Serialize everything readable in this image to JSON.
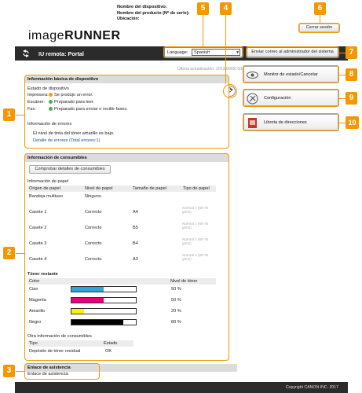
{
  "header": {
    "logo_main": "image",
    "logo_bold": "RUNNER",
    "device_name_label": "Nombre del dispositivo:",
    "product_name_label": "Nombre del producto (Nº de serie):",
    "location_label": "Ubicación:",
    "logout_label": "Cerrar sesión",
    "portal_title": "IU remota: Portal",
    "language_label": "Language:",
    "language_value": "Spanish",
    "mail_button": "Enviar correo al administrador del sistema",
    "last_updated": "Última actualización: 2013/00/00 00:00:00"
  },
  "basic_info": {
    "title": "Información básica de dispositivo",
    "status_title": "Estado de dispositivo",
    "printer_label": "Impresora:",
    "printer_status": "Se produjo un error.",
    "scanner_label": "Escáner:",
    "scanner_status": "Preparado para leer.",
    "fax_label": "Fax:",
    "fax_status": "Preparado para enviar o recibir faxes.",
    "errors_title": "Información de errores",
    "error_message": "El nivel de tinta del tóner amarillo es bajo.",
    "error_link": "Detalle de errores (Total errores:1)"
  },
  "consumables": {
    "title": "Información de consumibles",
    "check_button": "Comprobar detalles de consumibles",
    "paper_title": "Información de papel",
    "paper_headers": [
      "Origen de papel",
      "Nivel de papel",
      "Tamaño de papel",
      "Tipo de papel"
    ],
    "paper_rows": [
      {
        "source": "Bandeja multiuso",
        "level": "Ninguno",
        "size": "",
        "type": ""
      },
      {
        "source": "Casete 1",
        "level": "Correcto",
        "size": "A4",
        "type": "Normal 1 (60-75 g/m2)"
      },
      {
        "source": "Casete 2",
        "level": "Correcto",
        "size": "B5",
        "type": "Normal 1 (60-75 g/m2)"
      },
      {
        "source": "Casete 3",
        "level": "Correcto",
        "size": "B4",
        "type": "Normal 1 (60-75 g/m2)"
      },
      {
        "source": "Casete 4",
        "level": "Correcto",
        "size": "A3",
        "type": "Normal 1 (60-75 g/m2)"
      }
    ],
    "toner_title": "Tóner restante",
    "toner_headers": [
      "Color",
      "Nivel de tóner"
    ],
    "toner_rows": [
      {
        "color": "Cian",
        "level": "50 %",
        "fraction": 0.5,
        "hex": "#29a8e0"
      },
      {
        "color": "Magenta",
        "level": "50 %",
        "fraction": 0.5,
        "hex": "#e4007f"
      },
      {
        "color": "Amarillo",
        "level": "20 %",
        "fraction": 0.2,
        "hex": "#fff100"
      },
      {
        "color": "Negro",
        "level": "80 %",
        "fraction": 0.8,
        "hex": "#000000"
      }
    ],
    "other_title": "Otra información de consumibles",
    "other_headers": [
      "Tipo",
      "Estado"
    ],
    "other_row": {
      "type": "Depósito de tóner residual",
      "status": "OK"
    }
  },
  "support": {
    "title": "Enlace de asistencia",
    "text": "Enlace de asistencia:"
  },
  "side_buttons": [
    {
      "label": "Monitor de estado/Cancelar"
    },
    {
      "label": "Configuración"
    },
    {
      "label": "Libreta de direcciones"
    }
  ],
  "callouts": [
    "1",
    "2",
    "3",
    "4",
    "5",
    "6",
    "7",
    "8",
    "9",
    "10"
  ],
  "footer": {
    "copyright": "Copyright CANON INC. 2017"
  },
  "colors": {
    "callout": "#f39800",
    "titlebar": "#2b2b2b",
    "status_ok": "#4caf50"
  }
}
